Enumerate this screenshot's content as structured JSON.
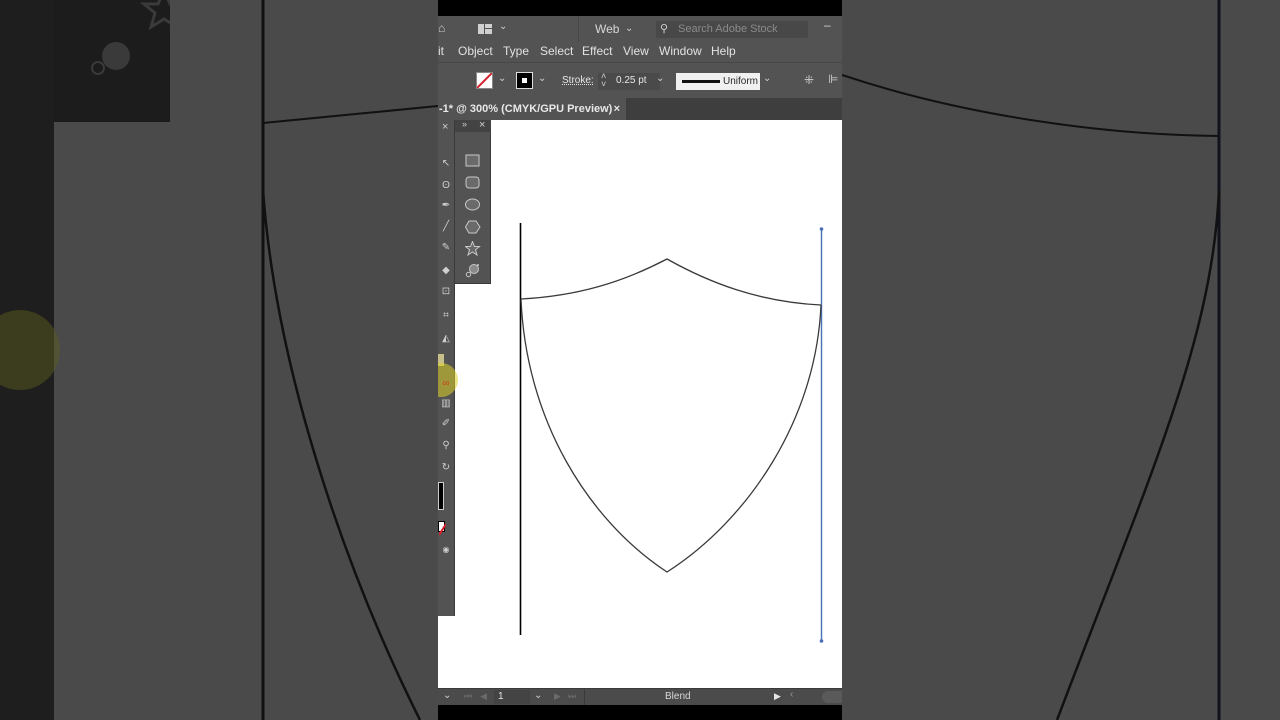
{
  "app": {
    "workspace_label": "Web",
    "search_placeholder": "Search Adobe Stock",
    "minimize_glyph": "–"
  },
  "menu": {
    "items": [
      "it",
      "Object",
      "Type",
      "Select",
      "Effect",
      "View",
      "Window",
      "Help"
    ]
  },
  "control_bar": {
    "stroke_label": "Stroke:",
    "stroke_weight": "0.25 pt",
    "profile_label": "Uniform"
  },
  "document_tab": {
    "title": "-1* @ 300% (CMYK/GPU Preview)",
    "close_glyph": "×"
  },
  "panels": {
    "tools_close": "×",
    "shape_panel_collapse": "»",
    "shape_panel_close": "×",
    "shape_tools": [
      "rectangle-tool",
      "rounded-rectangle-tool",
      "ellipse-tool",
      "polygon-tool",
      "star-tool",
      "flare-tool"
    ]
  },
  "status_bar": {
    "artboard_number": "1",
    "current_tool": "Blend"
  },
  "colors": {
    "ui_panel": "#535353",
    "canvas": "#ffffff",
    "selection_blue": "#4a6fb5",
    "stroke_black": "#000000",
    "fill_none_red": "#d4202a"
  }
}
